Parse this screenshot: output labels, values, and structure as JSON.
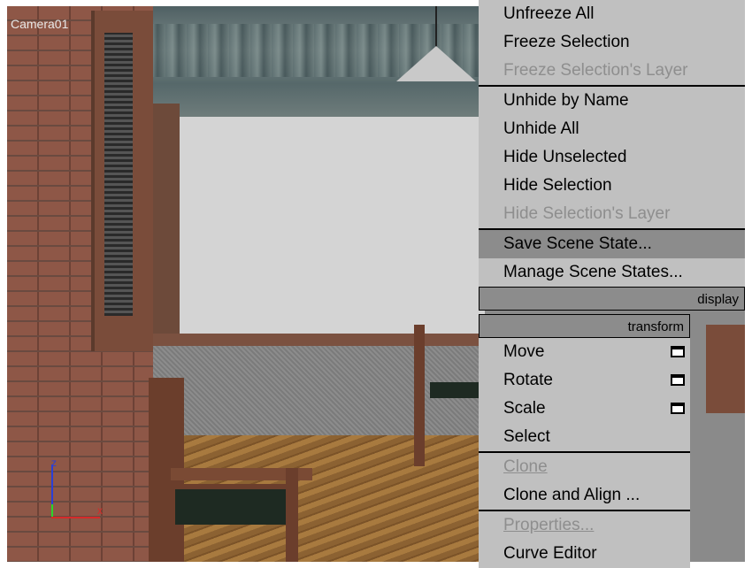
{
  "viewport": {
    "camera_label": "Camera01",
    "axis_labels": {
      "z": "z",
      "x": "x"
    }
  },
  "display_quad": {
    "header": "display",
    "items": [
      {
        "label": "Unfreeze All",
        "enabled": true
      },
      {
        "label": "Freeze Selection",
        "enabled": true
      },
      {
        "label": "Freeze Selection's Layer",
        "enabled": false
      },
      {
        "label": "Unhide by Name",
        "enabled": true
      },
      {
        "label": "Unhide All",
        "enabled": true
      },
      {
        "label": "Hide Unselected",
        "enabled": true
      },
      {
        "label": "Hide Selection",
        "enabled": true
      },
      {
        "label": "Hide Selection's Layer",
        "enabled": false
      },
      {
        "label": "Save Scene State...",
        "enabled": true,
        "highlighted": true
      },
      {
        "label": "Manage Scene States...",
        "enabled": true
      }
    ]
  },
  "transform_quad": {
    "header": "transform",
    "items": [
      {
        "label": "Move",
        "enabled": true,
        "icon": "options-box-icon"
      },
      {
        "label": "Rotate",
        "enabled": true,
        "icon": "options-box-icon"
      },
      {
        "label": "Scale",
        "enabled": true,
        "icon": "options-box-icon"
      },
      {
        "label": "Select",
        "enabled": true
      },
      {
        "label": "Clone",
        "enabled": false
      },
      {
        "label": "Clone and Align ...",
        "enabled": true
      },
      {
        "label": "Properties...",
        "enabled": false
      },
      {
        "label": "Curve Editor",
        "enabled": true
      }
    ]
  },
  "colors": {
    "menu_bg": "#c0c0c0",
    "menu_highlight": "#8c8c8c",
    "disabled_text": "#8e8e8e"
  }
}
